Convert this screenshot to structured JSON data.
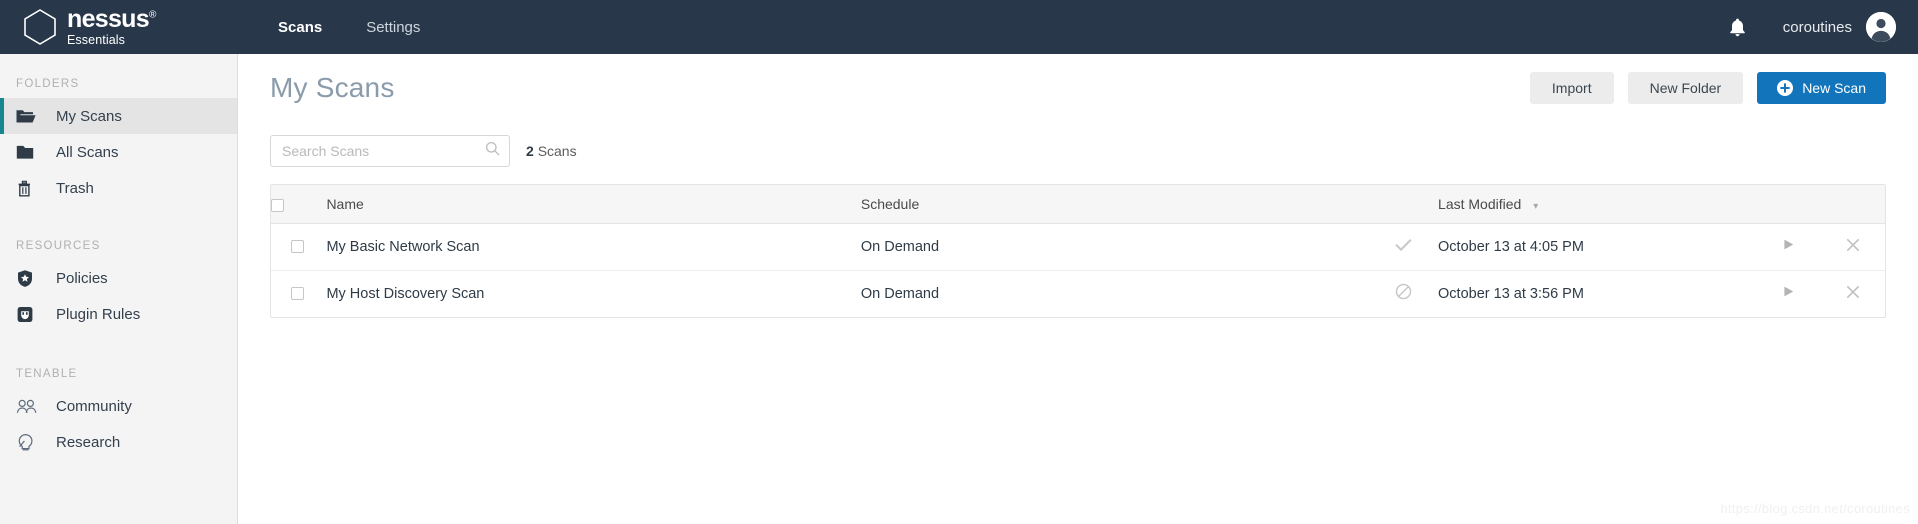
{
  "brand": {
    "name": "nessus",
    "trademark": "®",
    "edition": "Essentials",
    "logo_icon": "nessus-hexagon-logo"
  },
  "topnav": {
    "links": [
      {
        "label": "Scans",
        "active": true
      },
      {
        "label": "Settings",
        "active": false
      }
    ],
    "notifications_icon": "bell-icon",
    "username": "coroutines",
    "avatar_icon": "user-avatar-icon",
    "background_color": "#28384a"
  },
  "sidebar": {
    "sections": [
      {
        "title": "FOLDERS",
        "items": [
          {
            "label": "My Scans",
            "icon": "folder-open-icon",
            "active": true
          },
          {
            "label": "All Scans",
            "icon": "folder-icon",
            "active": false
          },
          {
            "label": "Trash",
            "icon": "trash-icon",
            "active": false
          }
        ]
      },
      {
        "title": "RESOURCES",
        "items": [
          {
            "label": "Policies",
            "icon": "shield-star-icon",
            "active": false
          },
          {
            "label": "Plugin Rules",
            "icon": "plugin-rules-icon",
            "active": false
          }
        ]
      },
      {
        "title": "TENABLE",
        "items": [
          {
            "label": "Community",
            "icon": "community-people-icon",
            "active": false
          },
          {
            "label": "Research",
            "icon": "research-bulb-icon",
            "active": false
          }
        ]
      }
    ],
    "active_accent_color": "#16868f"
  },
  "main": {
    "page_title": "My Scans",
    "actions": {
      "import_label": "Import",
      "new_folder_label": "New Folder",
      "new_scan_label": "New Scan",
      "new_scan_icon": "plus-circle-icon",
      "primary_color": "#1275bc"
    },
    "search": {
      "placeholder": "Search Scans",
      "value": "",
      "icon": "search-icon"
    },
    "scan_count_number": "2",
    "scan_count_label": "Scans",
    "table": {
      "select_all_checkbox": "unchecked",
      "columns": {
        "name": "Name",
        "schedule": "Schedule",
        "last_modified": "Last Modified",
        "sort_caret": "▾"
      },
      "rows": [
        {
          "checkbox": "unchecked",
          "name": "My Basic Network Scan",
          "schedule": "On Demand",
          "status_icon": "check-icon",
          "last_modified": "October 13 at 4:05 PM",
          "launch_icon": "play-icon",
          "delete_icon": "close-x-icon"
        },
        {
          "checkbox": "unchecked",
          "name": "My Host Discovery Scan",
          "schedule": "On Demand",
          "status_icon": "canceled-circle-slash-icon",
          "last_modified": "October 13 at 3:56 PM",
          "launch_icon": "play-icon",
          "delete_icon": "close-x-icon"
        }
      ]
    }
  },
  "watermark": "https://blog.csdn.net/coroutines"
}
